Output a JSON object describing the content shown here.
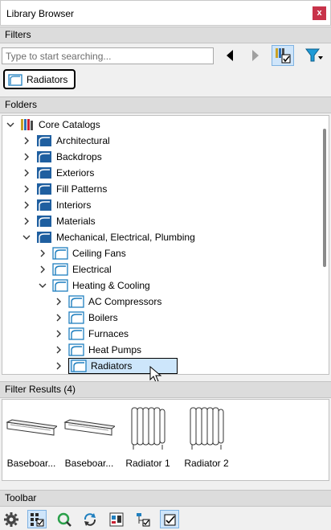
{
  "window": {
    "title": "Library Browser",
    "close_glyph": "x"
  },
  "filters": {
    "header": "Filters",
    "search_placeholder": "Type to start searching...",
    "chip_label": "Radiators"
  },
  "folders": {
    "header": "Folders",
    "items": [
      {
        "label": "Core Catalogs",
        "level": 0,
        "expanded": true,
        "icon": "catalog-books-icon"
      },
      {
        "label": "Architectural",
        "level": 1,
        "expanded": false,
        "icon": "folder-dark-icon"
      },
      {
        "label": "Backdrops",
        "level": 1,
        "expanded": false,
        "icon": "folder-dark-icon"
      },
      {
        "label": "Exteriors",
        "level": 1,
        "expanded": false,
        "icon": "folder-dark-icon"
      },
      {
        "label": "Fill Patterns",
        "level": 1,
        "expanded": false,
        "icon": "folder-dark-icon"
      },
      {
        "label": "Interiors",
        "level": 1,
        "expanded": false,
        "icon": "folder-dark-icon"
      },
      {
        "label": "Materials",
        "level": 1,
        "expanded": false,
        "icon": "folder-dark-icon"
      },
      {
        "label": "Mechanical, Electrical, Plumbing",
        "level": 1,
        "expanded": true,
        "icon": "folder-dark-icon"
      },
      {
        "label": "Ceiling Fans",
        "level": 2,
        "expanded": false,
        "icon": "folder-light-icon"
      },
      {
        "label": "Electrical",
        "level": 2,
        "expanded": false,
        "icon": "folder-light-icon"
      },
      {
        "label": "Heating & Cooling",
        "level": 2,
        "expanded": true,
        "icon": "folder-light-icon"
      },
      {
        "label": "AC Compressors",
        "level": 3,
        "expanded": false,
        "icon": "folder-light-icon"
      },
      {
        "label": "Boilers",
        "level": 3,
        "expanded": false,
        "icon": "folder-light-icon"
      },
      {
        "label": "Furnaces",
        "level": 3,
        "expanded": false,
        "icon": "folder-light-icon"
      },
      {
        "label": "Heat Pumps",
        "level": 3,
        "expanded": false,
        "icon": "folder-light-icon"
      },
      {
        "label": "Radiators",
        "level": 3,
        "expanded": false,
        "icon": "folder-light-icon",
        "selected": true
      }
    ]
  },
  "results": {
    "header": "Filter Results (4)",
    "items": [
      {
        "label": "Baseboar...",
        "icon": "baseboard-heater-icon"
      },
      {
        "label": "Baseboar...",
        "icon": "baseboard-heater-icon"
      },
      {
        "label": "Radiator 1",
        "icon": "radiator-icon"
      },
      {
        "label": "Radiator 2",
        "icon": "radiator-icon"
      }
    ]
  },
  "toolbar": {
    "header": "Toolbar"
  }
}
